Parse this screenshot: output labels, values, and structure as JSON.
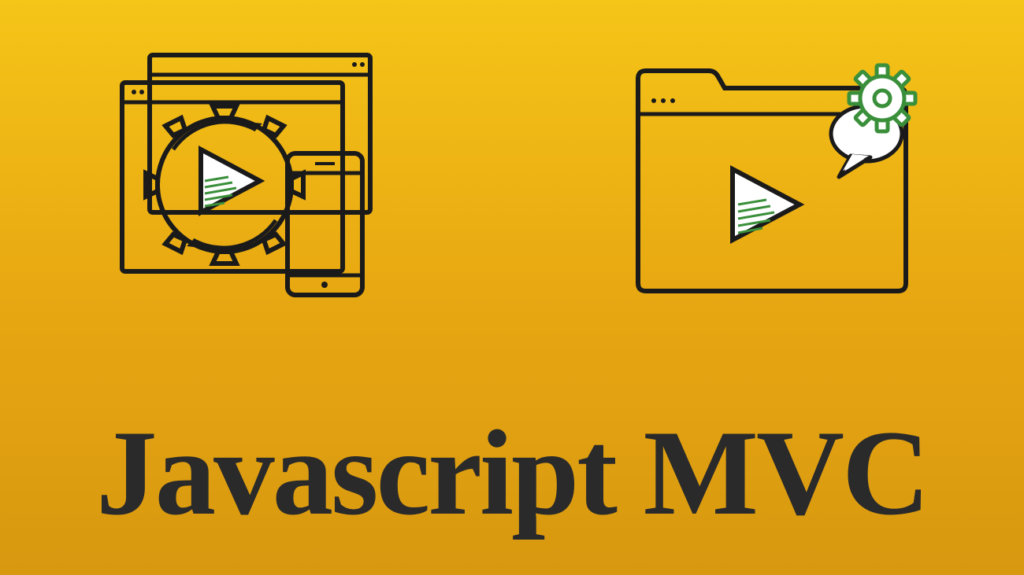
{
  "title": "Javascript MVC",
  "colors": {
    "background_top": "#f5c518",
    "background_bottom": "#d89810",
    "text": "#2a2a2a",
    "stroke": "#1a1a1a",
    "accent_green": "#3a8f3a",
    "white": "#ffffff"
  },
  "icons": {
    "left": "devices-gear-play",
    "right": "folder-gear-play"
  }
}
